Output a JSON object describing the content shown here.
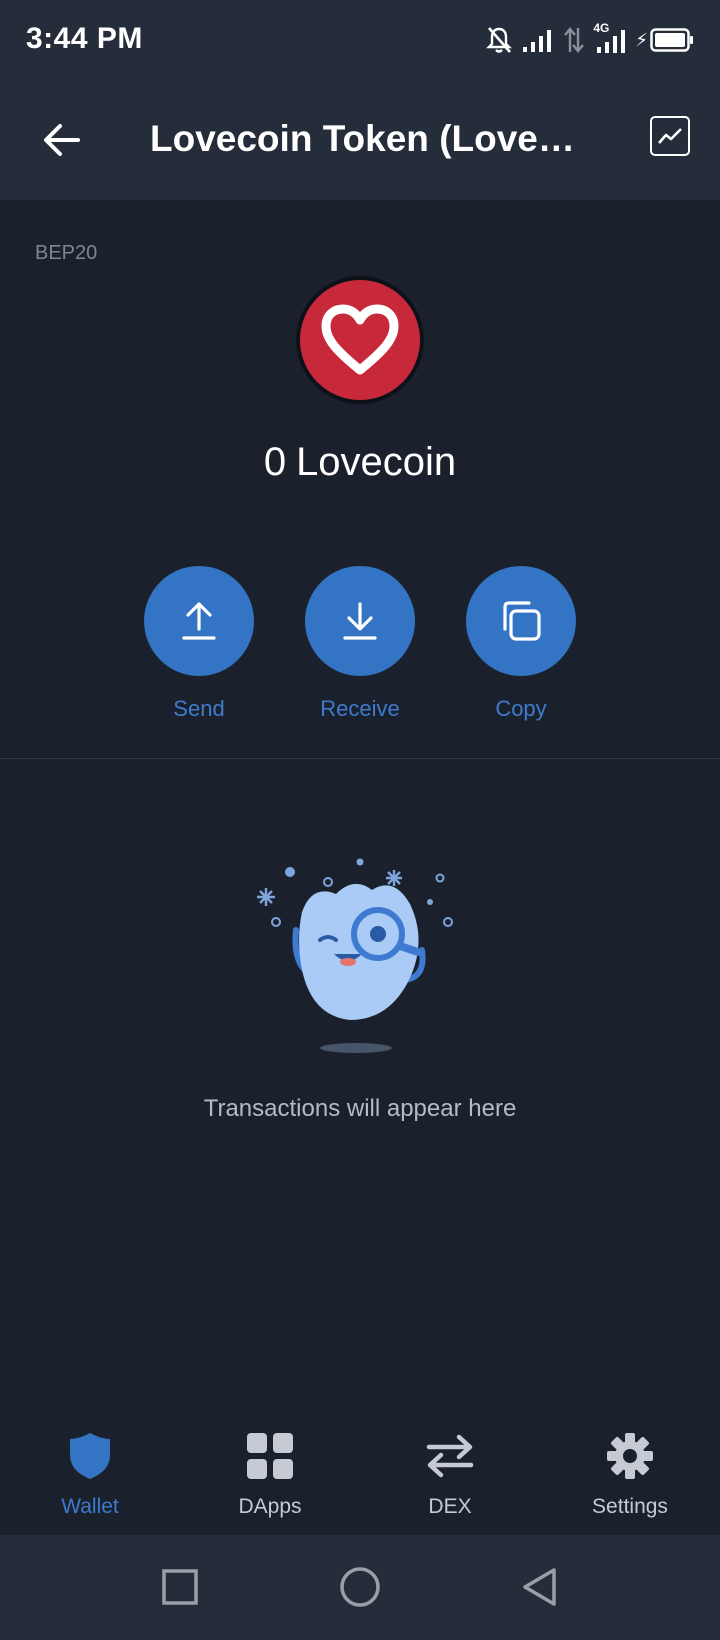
{
  "status_bar": {
    "time": "3:44 PM",
    "network_label": "4G"
  },
  "header": {
    "title": "Lovecoin Token (Loveco…"
  },
  "token": {
    "network": "BEP20",
    "balance_amount": "0",
    "balance_symbol": "Lovecoin",
    "logo_color": "#c7293b"
  },
  "actions": [
    {
      "label": "Send",
      "icon": "upload-arrow-icon"
    },
    {
      "label": "Receive",
      "icon": "download-arrow-icon"
    },
    {
      "label": "Copy",
      "icon": "copy-icon"
    }
  ],
  "empty_state": {
    "message": "Transactions will appear here"
  },
  "bottom_nav": [
    {
      "label": "Wallet",
      "icon": "shield-icon",
      "active": true
    },
    {
      "label": "DApps",
      "icon": "grid-icon",
      "active": false
    },
    {
      "label": "DEX",
      "icon": "swap-arrows-icon",
      "active": false
    },
    {
      "label": "Settings",
      "icon": "gear-icon",
      "active": false
    }
  ],
  "colors": {
    "background": "#1b202d",
    "header": "#252d3b",
    "accent": "#3374c4"
  }
}
